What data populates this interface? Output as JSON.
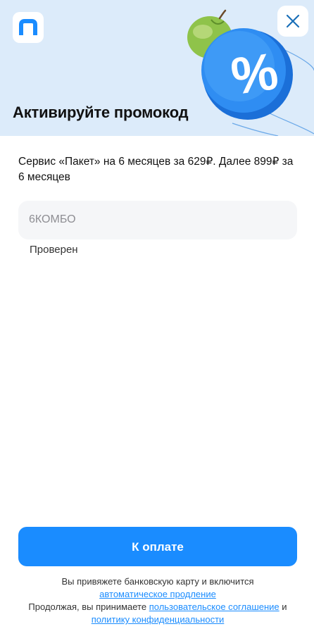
{
  "header": {
    "title": "Активируйте промокод",
    "logo_icon": "app-logo",
    "close_icon": "close-icon"
  },
  "offer": {
    "description": "Сервис «Пакет» на 6 месяцев за 629₽. Далее 899₽ за 6 месяцев"
  },
  "promo": {
    "value": "6КОМБО",
    "status": "Проверен"
  },
  "pay_button": {
    "label": "К оплате"
  },
  "legal": {
    "text1": "Вы привяжете банковскую карту и включится",
    "link_autorenew": "автоматическое продление",
    "text2": "Продолжая, вы принимаете",
    "link_agreement": "пользовательское соглашение",
    "text3": "и",
    "link_privacy": "политику конфиденциальности"
  },
  "colors": {
    "accent": "#1a8cff",
    "hero_bg": "#dcebfa"
  }
}
